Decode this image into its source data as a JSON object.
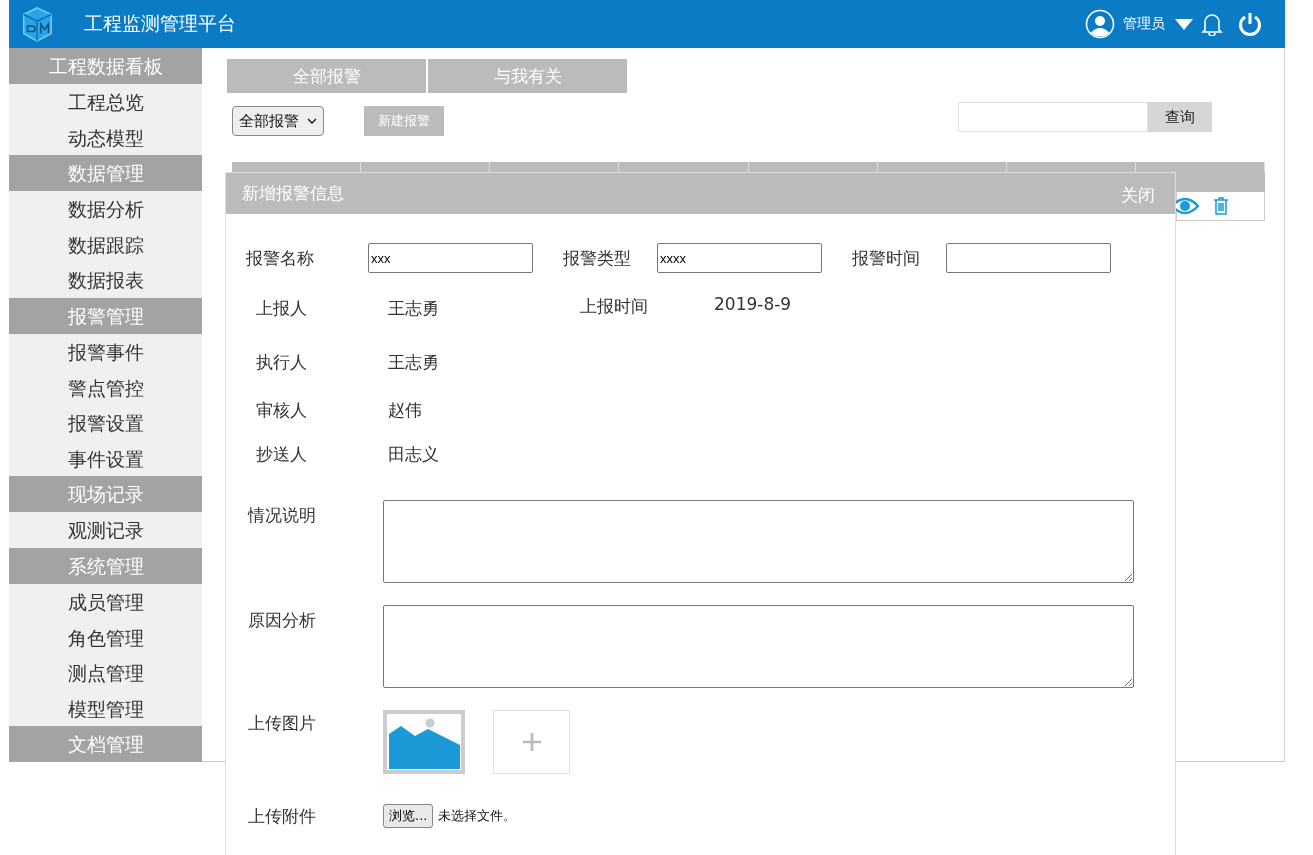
{
  "header": {
    "title": "工程监测管理平台",
    "user": "管理员"
  },
  "sidebar": {
    "groups": [
      {
        "title": "工程数据看板",
        "items": [
          "工程总览",
          "动态模型"
        ]
      },
      {
        "title": "数据管理",
        "items": [
          "数据分析",
          "数据跟踪",
          "数据报表"
        ]
      },
      {
        "title": "报警管理",
        "items": [
          "报警事件",
          "警点管控",
          "报警设置",
          "事件设置"
        ]
      },
      {
        "title": "现场记录",
        "items": [
          "观测记录"
        ]
      },
      {
        "title": "系统管理",
        "items": [
          "成员管理",
          "角色管理",
          "测点管理",
          "模型管理"
        ]
      },
      {
        "title": "文档管理"
      }
    ]
  },
  "tabs": [
    {
      "label": "全部报警",
      "selected": false
    },
    {
      "label": "与我有关",
      "selected": false
    }
  ],
  "toolbar": {
    "filter": "全部报警",
    "new_button": "新建报警",
    "search_button": "查询"
  },
  "modal": {
    "title": "新增报警信息",
    "close": "关闭",
    "input_row": [
      {
        "label": "报警名称",
        "value": "xxx"
      },
      {
        "label": "报警类型",
        "value": "xxxx"
      },
      {
        "label": "报警时间"
      }
    ],
    "info_rows": [
      [
        {
          "label": "上报人",
          "value": "王志勇"
        },
        {
          "label": "上报时间",
          "value": "2019-8-9"
        }
      ],
      [
        {
          "label": "执行人",
          "value": "王志勇"
        }
      ],
      [
        {
          "label": "审核人",
          "value": "赵伟"
        }
      ],
      [
        {
          "label": "抄送人",
          "value": "田志义"
        }
      ]
    ],
    "textareas": [
      {
        "label": "情况说明"
      },
      {
        "label": "原因分析"
      }
    ],
    "image_label": "上传图片",
    "file_label": "上传附件",
    "file_button": "浏览...",
    "file_status": "未选择文件。"
  }
}
